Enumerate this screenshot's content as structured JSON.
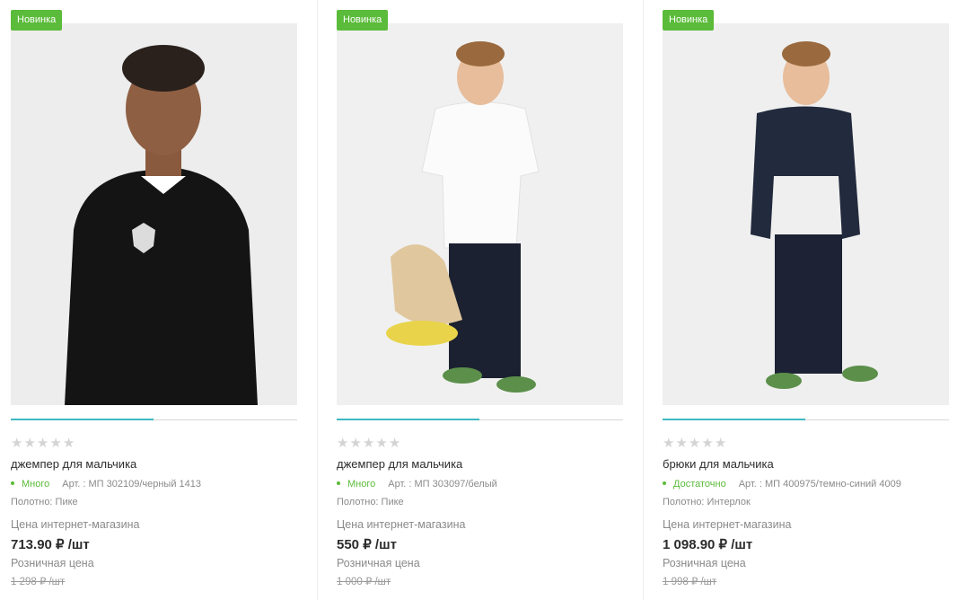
{
  "products": [
    {
      "badge": "Новинка",
      "rating_stars": [
        "★",
        "★",
        "★",
        "★",
        "★"
      ],
      "title": "джемпер для мальчика",
      "availability": "Много",
      "article": "Арт. : МП 302109/черный 1413",
      "fabric": "Полотно: Пике",
      "online_label": "Цена интернет-магазина",
      "price": "713.90 ₽ /шт",
      "retail_label": "Розничная цена",
      "old_price": "1 298 ₽ /шт"
    },
    {
      "badge": "Новинка",
      "rating_stars": [
        "★",
        "★",
        "★",
        "★",
        "★"
      ],
      "title": "джемпер для мальчика",
      "availability": "Много",
      "article": "Арт. : МП 303097/белый",
      "fabric": "Полотно: Пике",
      "online_label": "Цена интернет-магазина",
      "price": "550 ₽ /шт",
      "retail_label": "Розничная цена",
      "old_price": "1 000 ₽ /шт"
    },
    {
      "badge": "Новинка",
      "rating_stars": [
        "★",
        "★",
        "★",
        "★",
        "★"
      ],
      "title": "брюки для мальчика",
      "availability": "Достаточно",
      "article": "Арт. : МП 400975/темно-синий 4009",
      "fabric": "Полотно: Интерлок",
      "online_label": "Цена интернет-магазина",
      "price": "1 098.90 ₽ /шт",
      "retail_label": "Розничная цена",
      "old_price": "1 998 ₽ /шт"
    }
  ],
  "colors": {
    "badge": "#5bbb3a",
    "availability": "#5bbb3a",
    "slider": "#3fb9c2",
    "star": "#d4d4d4"
  },
  "icons": [
    "star-icon"
  ]
}
